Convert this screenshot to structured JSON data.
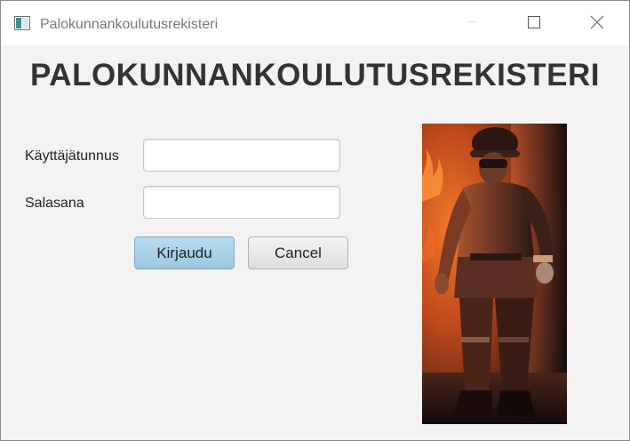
{
  "window": {
    "title": "Palokunnankoulutusrekisteri"
  },
  "main": {
    "heading": "PALOKUNNANKOULUTUSREKISTERI"
  },
  "form": {
    "username_label": "Käyttäjätunnus",
    "username_value": "",
    "password_label": "Salasana",
    "password_value": "",
    "login_label": "Kirjaudu",
    "cancel_label": "Cancel"
  },
  "icons": {
    "app": "app-window-icon",
    "minimize": "minimize-icon",
    "maximize": "maximize-icon",
    "close": "close-icon"
  },
  "colors": {
    "login_button": "#a9d2ea",
    "heading": "#333333",
    "window_background": "#f3f3f3"
  }
}
